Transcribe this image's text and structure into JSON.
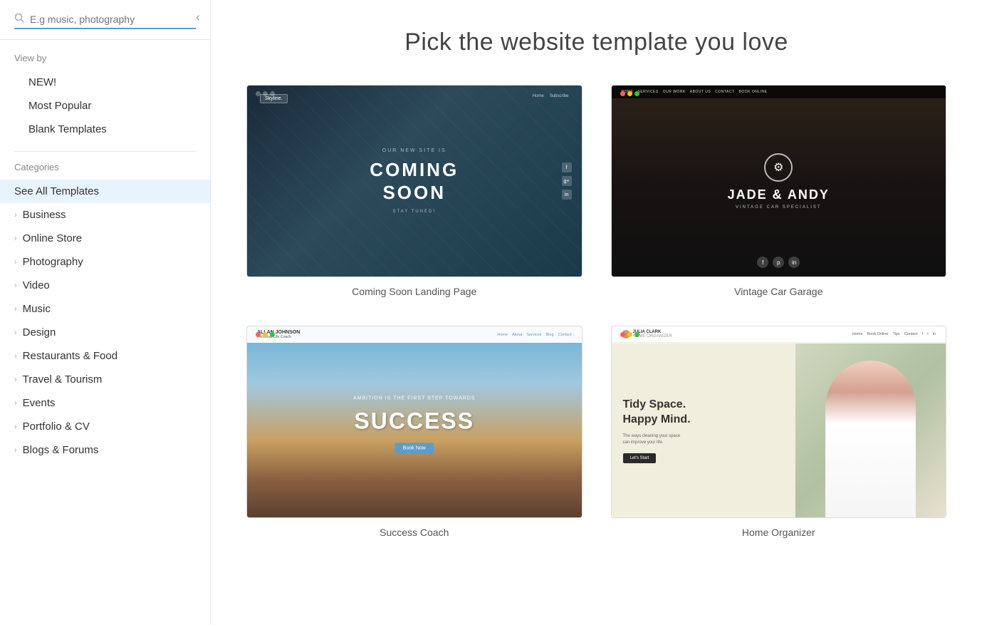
{
  "sidebar": {
    "collapse_btn": "‹",
    "search": {
      "placeholder": "E.g music, photography"
    },
    "viewby_label": "View by",
    "nav_items": [
      {
        "id": "new",
        "label": "NEW!"
      },
      {
        "id": "most-popular",
        "label": "Most Popular"
      },
      {
        "id": "blank-templates",
        "label": "Blank Templates"
      }
    ],
    "categories_label": "Categories",
    "categories": [
      {
        "id": "see-all",
        "label": "See All Templates",
        "active": true
      },
      {
        "id": "business",
        "label": "Business",
        "has_chevron": true
      },
      {
        "id": "online-store",
        "label": "Online Store",
        "has_chevron": true
      },
      {
        "id": "photography",
        "label": "Photography",
        "has_chevron": true
      },
      {
        "id": "video",
        "label": "Video",
        "has_chevron": true
      },
      {
        "id": "music",
        "label": "Music",
        "has_chevron": true
      },
      {
        "id": "design",
        "label": "Design",
        "has_chevron": true
      },
      {
        "id": "restaurants-food",
        "label": "Restaurants & Food",
        "has_chevron": true
      },
      {
        "id": "travel-tourism",
        "label": "Travel & Tourism",
        "has_chevron": true
      },
      {
        "id": "events",
        "label": "Events",
        "has_chevron": true
      },
      {
        "id": "portfolio-cv",
        "label": "Portfolio & CV",
        "has_chevron": true
      },
      {
        "id": "blogs-forums",
        "label": "Blogs & Forums",
        "has_chevron": true
      }
    ]
  },
  "main": {
    "title": "Pick the website template you love",
    "templates": [
      {
        "id": "coming-soon",
        "label": "Coming Soon Landing Page",
        "type": "coming-soon"
      },
      {
        "id": "vintage-car",
        "label": "Vintage Car Garage",
        "type": "vintage-car"
      },
      {
        "id": "success-coach",
        "label": "Success Coach",
        "type": "success-coach"
      },
      {
        "id": "home-organizer",
        "label": "Home Organizer",
        "type": "home-organizer"
      }
    ]
  }
}
